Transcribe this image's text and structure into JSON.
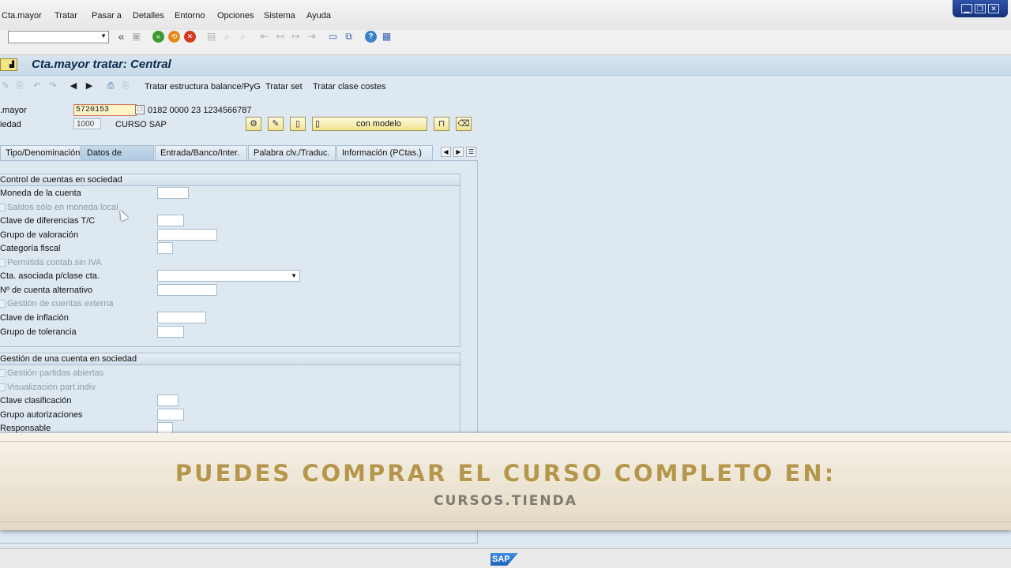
{
  "menu": {
    "items": [
      "Cta.mayor",
      "Tratar",
      "Pasar a",
      "Detalles",
      "Entorno",
      "Opciones",
      "Sistema",
      "Ayuda"
    ]
  },
  "window_controls": {
    "minimize": "▁",
    "maximize": "❐",
    "close": "✕"
  },
  "toolbar": {
    "command_value": "",
    "back_label": "«"
  },
  "title": {
    "text": "Cta.mayor tratar: Central"
  },
  "app_toolbar": {
    "links": [
      "Tratar estructura balance/PyG",
      "Tratar set",
      "Tratar clase costes"
    ]
  },
  "header_fields": {
    "account_label": ".mayor",
    "account_value": "5720153",
    "account_desc": "0182 0000 23 1234566787",
    "company_label": "iedad",
    "company_value": "1000",
    "company_name": "CURSO SAP",
    "with_template_label": "con modelo"
  },
  "tabs": [
    "Tipo/Denominación",
    "Datos de control",
    "Entrada/Banco/Inter.",
    "Palabra clv./Traduc.",
    "Información (PCtas.)"
  ],
  "active_tab": "Datos de control",
  "group1": {
    "title": "Control de cuentas en sociedad",
    "currency_label": "Moneda de la cuenta",
    "local_balance_label": "Saldos sólo en moneda local",
    "fx_key_label": "Clave de diferencias T/C",
    "valuation_group_label": "Grupo de valoración",
    "tax_category_label": "Categoría fiscal",
    "posting_no_tax_label": "Permitida contab.sin IVA",
    "recon_account_label": "Cta. asociada p/clase cta.",
    "alt_account_label": "Nº de cuenta alternativo",
    "ext_mgmt_label": "Gestión de cuentas externa",
    "inflation_key_label": "Clave de inflación",
    "tolerance_group_label": "Grupo de tolerancia"
  },
  "group2": {
    "title": "Gestión de una cuenta en sociedad",
    "open_items_label": "Gestión partidas abiertas",
    "line_items_label": "Visualización part.indiv.",
    "sort_key_label": "Clave clasificación",
    "auth_group_label": "Grupo autorizaciones",
    "responsible_label": "Responsable"
  },
  "banner": {
    "title": "PUEDES COMPRAR EL CURSO COMPLETO EN:",
    "subtitle": "CURSOS.TIENDA"
  },
  "status": {
    "logo": "SAP"
  }
}
